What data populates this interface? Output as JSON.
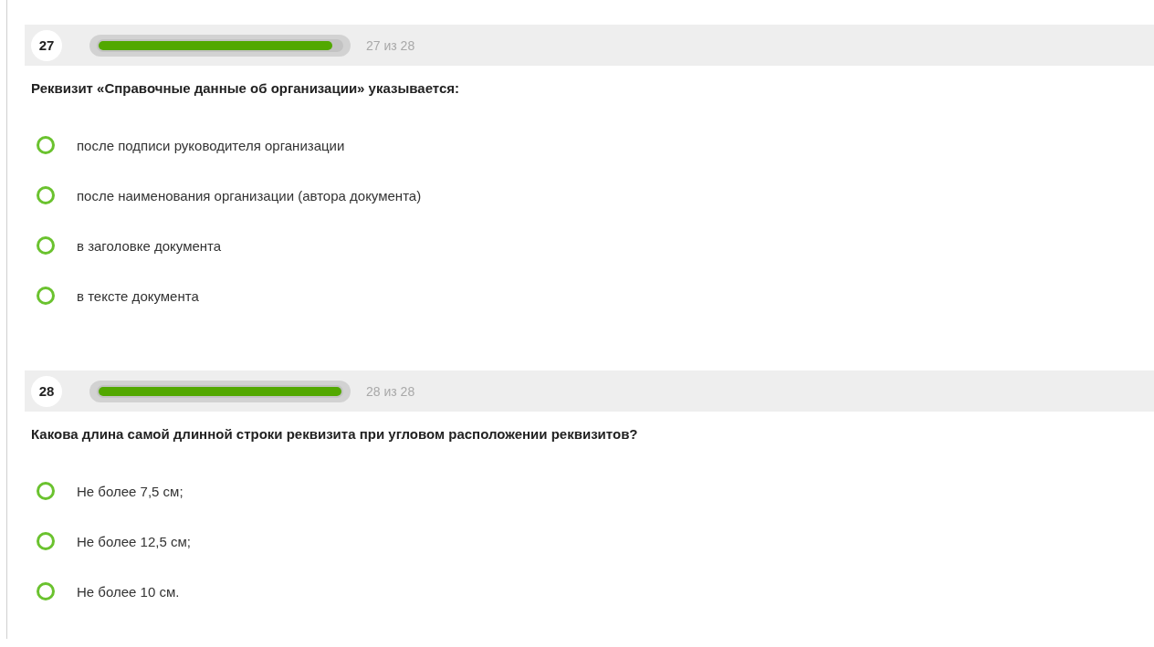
{
  "questions": [
    {
      "number": "27",
      "progress": {
        "level": 0.964,
        "label": "27 из 28"
      },
      "text": "Реквизит «Справочные данные об организации» указывается:",
      "options": [
        {
          "label": "после подписи руководителя организации",
          "selected": false
        },
        {
          "label": "после наименования организации (автора документа)",
          "selected": false
        },
        {
          "label": "в заголовке документа",
          "selected": false
        },
        {
          "label": "в тексте документа",
          "selected": false
        }
      ]
    },
    {
      "number": "28",
      "progress": {
        "level": 1,
        "label": "28 из 28"
      },
      "text": "Какова длина самой длинной строки реквизита при угловом расположении реквизитов?",
      "options": [
        {
          "label": "Не более 7,5 см;",
          "selected": false
        },
        {
          "label": "Не более 12,5 см;",
          "selected": false
        },
        {
          "label": "Не более 10 см.",
          "selected": false
        }
      ]
    }
  ]
}
